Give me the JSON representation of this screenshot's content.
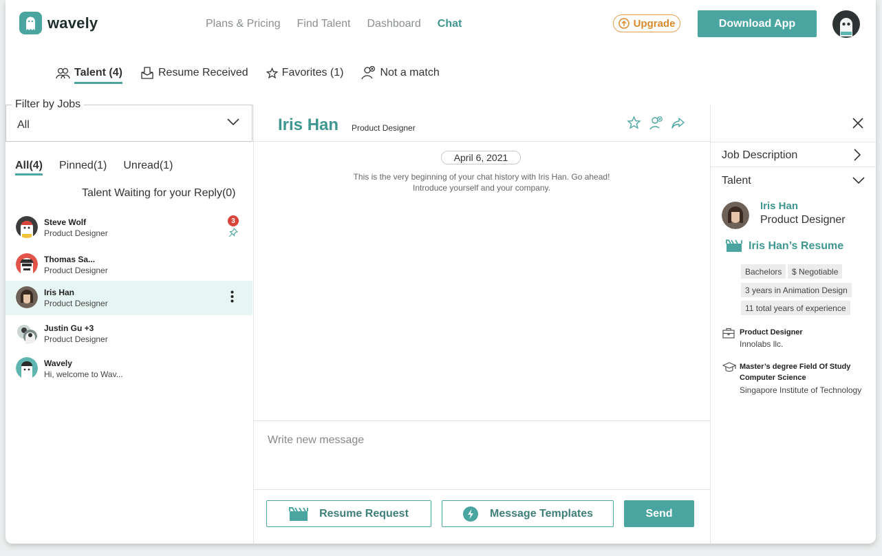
{
  "brand": {
    "name": "wavely",
    "color": "#4aa5a0"
  },
  "nav": {
    "items": [
      "Plans & Pricing",
      "Find Talent",
      "Dashboard",
      "Chat"
    ],
    "active": "Chat"
  },
  "header": {
    "upgrade_label": "Upgrade",
    "download_label": "Download App"
  },
  "tabs": [
    {
      "label": "Talent (4)",
      "icon": "people-icon",
      "active": true
    },
    {
      "label": "Resume Received",
      "icon": "document-icon",
      "active": false
    },
    {
      "label": "Favorites (1)",
      "icon": "star-icon",
      "active": false
    },
    {
      "label": "Not a match",
      "icon": "user-x-icon",
      "active": false
    }
  ],
  "filter": {
    "legend": "Filter by Jobs",
    "value": "All"
  },
  "subtabs": {
    "all": "All(4)",
    "pinned": "Pinned(1)",
    "unread": "Unread(1)"
  },
  "waiting_label": "Talent Waiting for your Reply(0)",
  "conversations": [
    {
      "name": "Steve Wolf",
      "subtitle": "Product Designer",
      "badge": "3",
      "pinned": true
    },
    {
      "name": "Thomas Sa...",
      "subtitle": "Product Designer"
    },
    {
      "name": "Iris Han",
      "subtitle": "Product Designer",
      "selected": true
    },
    {
      "name": "Justin Gu +3",
      "subtitle": "Product Designer"
    },
    {
      "name": "Wavely",
      "subtitle": "Hi, welcome to Wav..."
    }
  ],
  "chat": {
    "name": "Iris Han",
    "role": "Product Designer",
    "date": "April 6, 2021",
    "intro_line1": "This is the very beginning of your chat history with Iris Han. Go ahead!",
    "intro_line2": "Introduce yourself and your company.",
    "compose_placeholder": "Write new message",
    "resume_request_label": "Resume Request",
    "templates_label": "Message Templates",
    "send_label": "Send"
  },
  "panel": {
    "job_description": "Job Description",
    "talent": "Talent",
    "talent_name": "Iris Han",
    "talent_role": "Product Designer",
    "resume_link": "Iris Han’s Resume",
    "tags": [
      "Bachelors",
      "$ Negotiable",
      "3 years in Animation Design",
      "11 total years of experience"
    ],
    "experience": {
      "title": "Product Designer",
      "company": "Innolabs llc."
    },
    "education": {
      "degree": "Master’s degree Field Of Study",
      "field": "Computer Science",
      "school": "Singapore Institute of Technology"
    }
  }
}
